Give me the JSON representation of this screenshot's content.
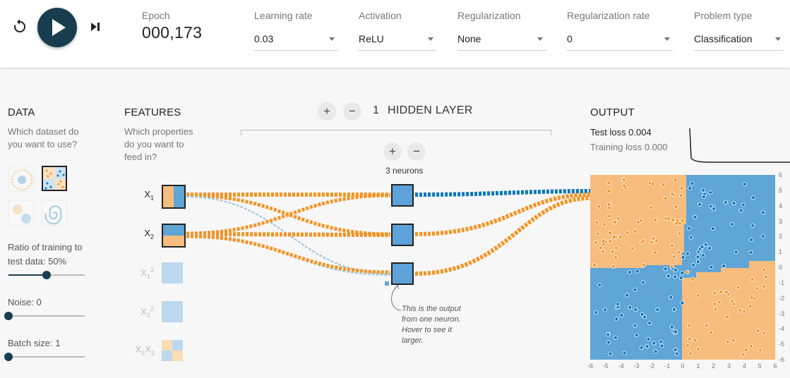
{
  "colors": {
    "orange": "#f59322",
    "blue": "#0877bd",
    "region_orange": "#f6bd7e",
    "region_blue": "#5fa5d6",
    "dark": "#183d4e"
  },
  "controls": {
    "reset_icon": "reset-icon",
    "play_icon": "play-icon",
    "step_icon": "step-forward-icon",
    "epoch_label": "Epoch",
    "epoch_value": "000,173",
    "learning_rate": {
      "label": "Learning rate",
      "value": "0.03"
    },
    "activation": {
      "label": "Activation",
      "value": "ReLU"
    },
    "regularization": {
      "label": "Regularization",
      "value": "None"
    },
    "regularization_rate": {
      "label": "Regularization rate",
      "value": "0"
    },
    "problem_type": {
      "label": "Problem type",
      "value": "Classification"
    }
  },
  "data_panel": {
    "title": "DATA",
    "subtitle_line1": "Which dataset do",
    "subtitle_line2": "you want to use?",
    "datasets": [
      "circle",
      "xor",
      "gaussian",
      "spiral"
    ],
    "selected_dataset": "xor",
    "ratio": {
      "label_line1": "Ratio of training to",
      "label_line2": "test data:  50%",
      "value": 0.5
    },
    "noise": {
      "label": "Noise:  0",
      "value": 0
    },
    "batch": {
      "label": "Batch size:  1",
      "value": 0
    }
  },
  "features_panel": {
    "title": "FEATURES",
    "subtitle_line1": "Which properties",
    "subtitle_line2": "do you want to",
    "subtitle_line3": "feed in?",
    "features": [
      {
        "label": "X1",
        "active": true
      },
      {
        "label": "X2",
        "active": true
      },
      {
        "label": "X12",
        "active": false
      },
      {
        "label": "X22",
        "active": false
      },
      {
        "label": "X1X2",
        "active": false
      }
    ]
  },
  "hidden": {
    "plus": "+",
    "minus": "−",
    "layer_count": "1",
    "layer_text": "HIDDEN LAYER",
    "neurons_label": "3 neurons",
    "callout_line1": "This is the output",
    "callout_line2": "from one neuron.",
    "callout_line3": "Hover to see it",
    "callout_line4": "larger."
  },
  "output": {
    "title": "OUTPUT",
    "test_loss": "Test loss 0.004",
    "training_loss": "Training loss 0.000",
    "x_ticks": [
      "-6",
      "-5",
      "-4",
      "-3",
      "-2",
      "-1",
      "0",
      "1",
      "2",
      "3",
      "4",
      "5",
      "6"
    ],
    "y_ticks": [
      "6",
      "5",
      "4",
      "3",
      "2",
      "1",
      "0",
      "-1",
      "-2",
      "-3",
      "-4",
      "-5",
      "-6"
    ]
  }
}
